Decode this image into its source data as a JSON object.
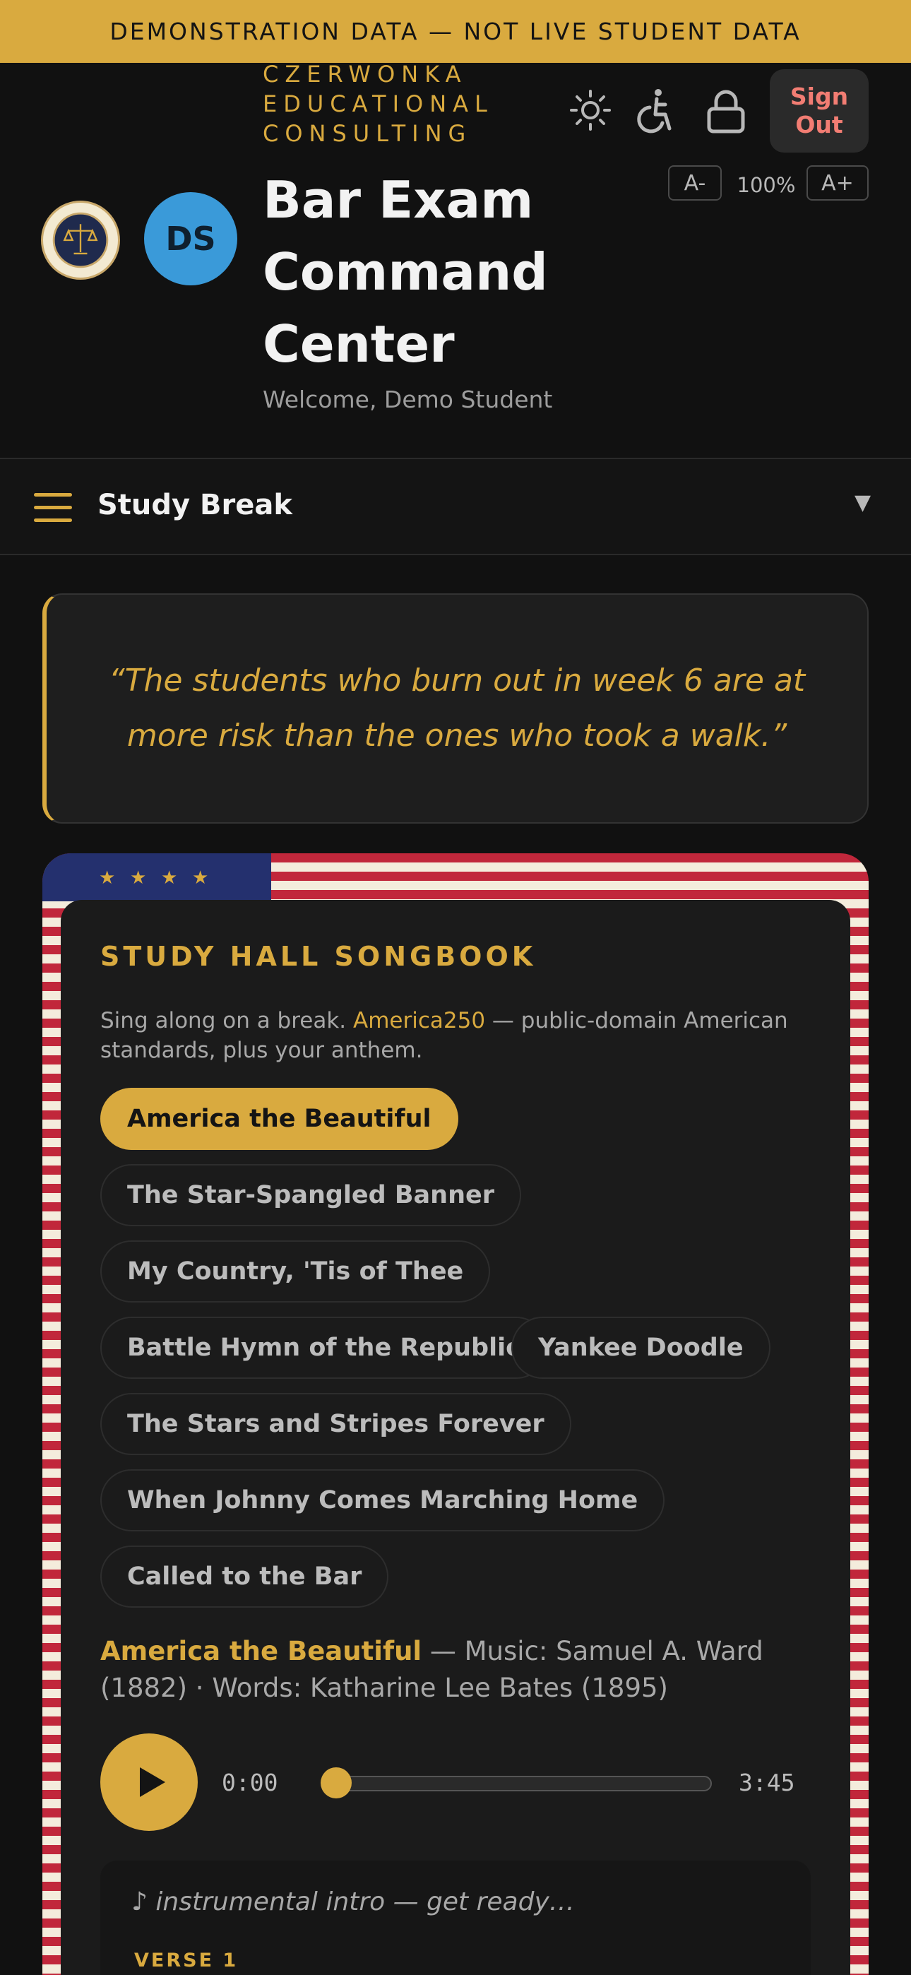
{
  "banner": "DEMONSTRATION DATA — NOT LIVE STUDENT DATA",
  "header": {
    "brand_lines": [
      "CZERWONKA",
      "EDUCATIONAL",
      "CONSULTING"
    ],
    "title_lines": [
      "Bar Exam",
      "Command",
      "Center"
    ],
    "welcome": "Welcome, Demo Student",
    "avatar_initials": "DS",
    "sign_out_line1": "Sign",
    "sign_out_line2": "Out",
    "font_decrease": "A-",
    "font_increase": "A+",
    "zoom": "100%",
    "seal_text": "CZERWONKA EDUCATIONAL CONSULTING",
    "icons": [
      "sun-icon",
      "accessibility-icon",
      "lock-icon"
    ]
  },
  "nav": {
    "current": "Study Break",
    "caret": "▼"
  },
  "quote": "“The students who burn out in week 6 are at more risk than the ones who took a walk.”",
  "songbook": {
    "title": "STUDY HALL SONGBOOK",
    "desc_before": "Sing along on a break. ",
    "desc_highlight": "America250",
    "desc_after": " — public-domain American standards, plus your anthem.",
    "songs": [
      "America the Beautiful",
      "The Star-Spangled Banner",
      "My Country, 'Tis of Thee",
      "Battle Hymn of the Republic",
      "Yankee Doodle",
      "The Stars and Stripes Forever",
      "When Johnny Comes Marching Home",
      "Called to the Bar"
    ],
    "selected_index": 0,
    "now_title": "America the Beautiful",
    "now_credits": " — Music: Samuel A. Ward (1882) · Words: Katharine Lee Bates (1895)",
    "player": {
      "current_time": "0:00",
      "duration": "3:45",
      "progress": 0
    },
    "lyrics_intro": "♪ instrumental intro — get ready…",
    "verse_label": "VERSE 1"
  },
  "colors": {
    "accent": "#d9aa3f",
    "background": "#111111",
    "signout": "#f27d73",
    "avatar": "#3a9ad9",
    "flag_red": "#c1273b",
    "flag_blue": "#24306e"
  }
}
